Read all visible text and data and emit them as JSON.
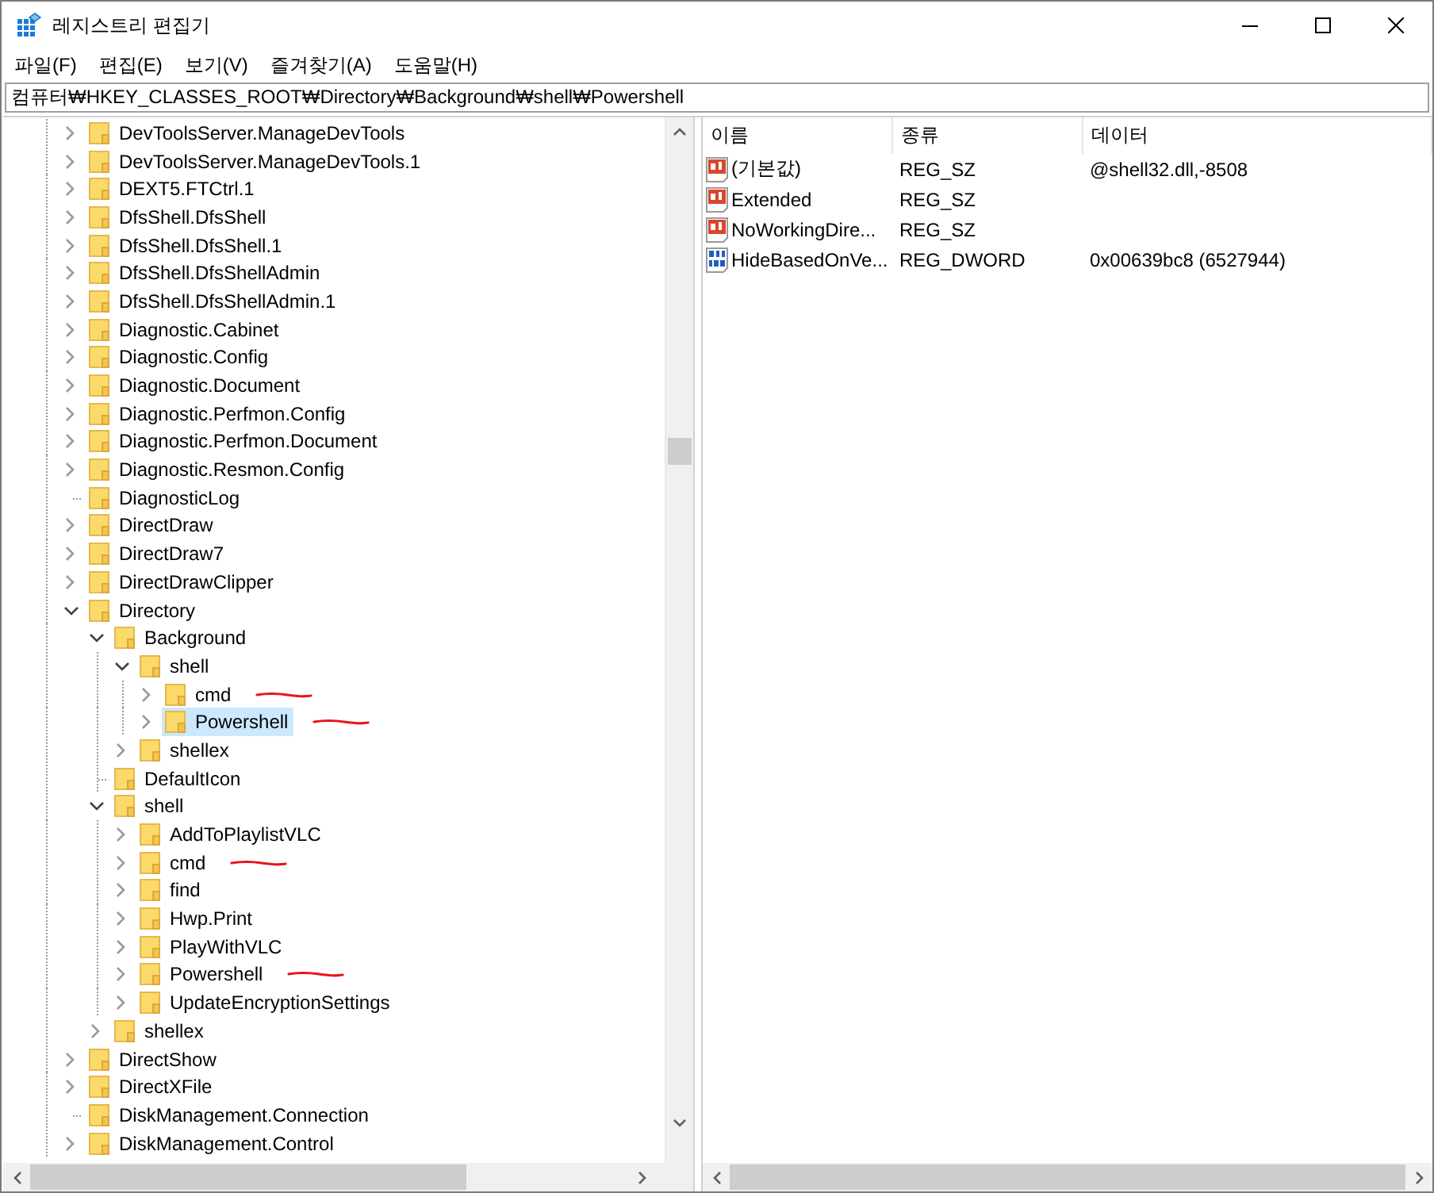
{
  "window": {
    "title": "레지스트리 편집기",
    "controls": [
      {
        "kind": "minimize"
      },
      {
        "kind": "maximize"
      },
      {
        "kind": "close"
      }
    ]
  },
  "menu": [
    "파일(F)",
    "편집(E)",
    "보기(V)",
    "즐겨찾기(A)",
    "도움말(H)"
  ],
  "address": {
    "value": "컴퓨터₩HKEY_CLASSES_ROOT₩Directory₩Background₩shell₩Powershell"
  },
  "tree": [
    {
      "label": "DevToolsServer.ManageDevTools",
      "kind": "node",
      "expanded": false,
      "selected": false,
      "marked": false
    },
    {
      "label": "DevToolsServer.ManageDevTools.1",
      "kind": "node",
      "expanded": false,
      "selected": false,
      "marked": false
    },
    {
      "label": "DEXT5.FTCtrl.1",
      "kind": "node",
      "expanded": false,
      "selected": false,
      "marked": false
    },
    {
      "label": "DfsShell.DfsShell",
      "kind": "node",
      "expanded": false,
      "selected": false,
      "marked": false
    },
    {
      "label": "DfsShell.DfsShell.1",
      "kind": "node",
      "expanded": false,
      "selected": false,
      "marked": false
    },
    {
      "label": "DfsShell.DfsShellAdmin",
      "kind": "node",
      "expanded": false,
      "selected": false,
      "marked": false
    },
    {
      "label": "DfsShell.DfsShellAdmin.1",
      "kind": "node",
      "expanded": false,
      "selected": false,
      "marked": false
    },
    {
      "label": "Diagnostic.Cabinet",
      "kind": "node",
      "expanded": false,
      "selected": false,
      "marked": false
    },
    {
      "label": "Diagnostic.Config",
      "kind": "node",
      "expanded": false,
      "selected": false,
      "marked": false
    },
    {
      "label": "Diagnostic.Document",
      "kind": "node",
      "expanded": false,
      "selected": false,
      "marked": false
    },
    {
      "label": "Diagnostic.Perfmon.Config",
      "kind": "node",
      "expanded": false,
      "selected": false,
      "marked": false
    },
    {
      "label": "Diagnostic.Perfmon.Document",
      "kind": "node",
      "expanded": false,
      "selected": false,
      "marked": false
    },
    {
      "label": "Diagnostic.Resmon.Config",
      "kind": "node",
      "expanded": false,
      "selected": false,
      "marked": false
    },
    {
      "label": "DiagnosticLog",
      "kind": "leaf",
      "selected": false,
      "marked": false
    },
    {
      "label": "DirectDraw",
      "kind": "node",
      "expanded": false,
      "selected": false,
      "marked": false
    },
    {
      "label": "DirectDraw7",
      "kind": "node",
      "expanded": false,
      "selected": false,
      "marked": false
    },
    {
      "label": "DirectDrawClipper",
      "kind": "node",
      "expanded": false,
      "selected": false,
      "marked": false
    },
    {
      "label": "Directory",
      "kind": "node",
      "expanded": true,
      "selected": false,
      "marked": false,
      "children": [
        {
          "label": "Background",
          "kind": "node",
          "expanded": true,
          "selected": false,
          "marked": false,
          "children": [
            {
              "label": "shell",
              "kind": "node",
              "expanded": true,
              "selected": false,
              "marked": false,
              "children": [
                {
                  "label": "cmd",
                  "kind": "node",
                  "expanded": false,
                  "selected": false,
                  "marked": true
                },
                {
                  "label": "Powershell",
                  "kind": "node",
                  "expanded": false,
                  "selected": true,
                  "marked": true
                }
              ]
            },
            {
              "label": "shellex",
              "kind": "node",
              "expanded": false,
              "selected": false,
              "marked": false
            }
          ]
        },
        {
          "label": "DefaultIcon",
          "kind": "leaf",
          "selected": false,
          "marked": false
        },
        {
          "label": "shell",
          "kind": "node",
          "expanded": true,
          "selected": false,
          "marked": false,
          "children": [
            {
              "label": "AddToPlaylistVLC",
              "kind": "node",
              "expanded": false,
              "selected": false,
              "marked": false
            },
            {
              "label": "cmd",
              "kind": "node",
              "expanded": false,
              "selected": false,
              "marked": true
            },
            {
              "label": "find",
              "kind": "node",
              "expanded": false,
              "selected": false,
              "marked": false
            },
            {
              "label": "Hwp.Print",
              "kind": "node",
              "expanded": false,
              "selected": false,
              "marked": false
            },
            {
              "label": "PlayWithVLC",
              "kind": "node",
              "expanded": false,
              "selected": false,
              "marked": false
            },
            {
              "label": "Powershell",
              "kind": "node",
              "expanded": false,
              "selected": false,
              "marked": true
            },
            {
              "label": "UpdateEncryptionSettings",
              "kind": "node",
              "expanded": false,
              "selected": false,
              "marked": false
            }
          ]
        },
        {
          "label": "shellex",
          "kind": "node",
          "expanded": false,
          "selected": false,
          "marked": false
        }
      ]
    },
    {
      "label": "DirectShow",
      "kind": "node",
      "expanded": false,
      "selected": false,
      "marked": false
    },
    {
      "label": "DirectXFile",
      "kind": "node",
      "expanded": false,
      "selected": false,
      "marked": false
    },
    {
      "label": "DiskManagement.Connection",
      "kind": "leaf",
      "selected": false,
      "marked": false
    },
    {
      "label": "DiskManagement.Control",
      "kind": "node",
      "expanded": false,
      "selected": false,
      "marked": false
    }
  ],
  "values": {
    "columns": [
      "이름",
      "종류",
      "데이터"
    ],
    "rows": [
      {
        "kind": "string",
        "name": "(기본값)",
        "type": "REG_SZ",
        "data": "@shell32.dll,-8508"
      },
      {
        "kind": "string",
        "name": "Extended",
        "type": "REG_SZ"
      },
      {
        "kind": "string",
        "name": "NoWorkingDire...",
        "type": "REG_SZ"
      },
      {
        "kind": "binary",
        "name": "HideBasedOnVe...",
        "type": "REG_DWORD",
        "data": "0x00639bc8 (6527944)"
      }
    ]
  }
}
